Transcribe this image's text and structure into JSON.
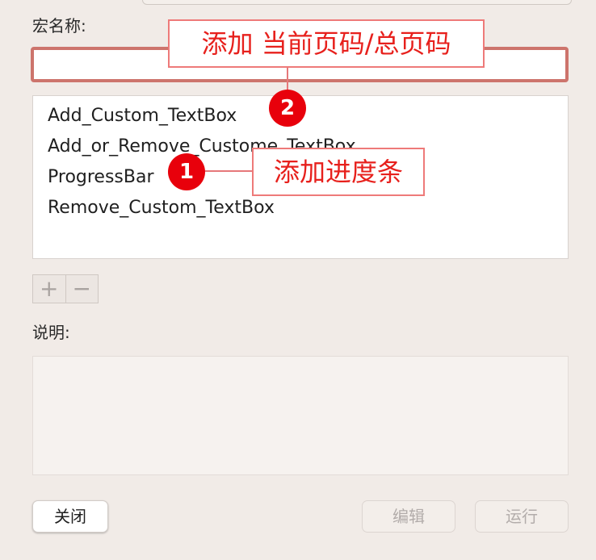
{
  "labels": {
    "macro_name": "宏名称:",
    "description": "说明:"
  },
  "name_input": {
    "value": "",
    "placeholder": ""
  },
  "macro_list": [
    "Add_Custom_TextBox",
    "Add_or_Remove_Custome_TextBox",
    "ProgressBar",
    "Remove_Custom_TextBox"
  ],
  "list_controls": {
    "add_symbol": "+",
    "remove_symbol": "−",
    "add_icon": "plus-icon",
    "remove_icon": "minus-icon"
  },
  "description_text": "",
  "buttons": {
    "close": "关闭",
    "edit": "编辑",
    "run": "运行"
  },
  "annotations": {
    "top_text": "添加 当前页码/总页码",
    "right_text": "添加进度条",
    "marker_1": "1",
    "marker_2": "2",
    "color": "#e7201c"
  }
}
